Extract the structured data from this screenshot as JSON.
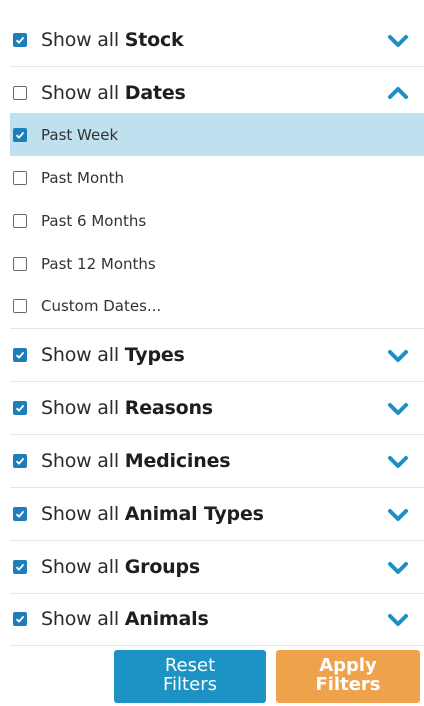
{
  "sections": {
    "stock": {
      "prefix": "Show all",
      "name": "Stock",
      "checked": true,
      "expanded": false
    },
    "dates": {
      "prefix": "Show all",
      "name": "Dates",
      "checked": false,
      "expanded": true
    },
    "types": {
      "prefix": "Show all",
      "name": "Types",
      "checked": true,
      "expanded": false
    },
    "reasons": {
      "prefix": "Show all",
      "name": "Reasons",
      "checked": true,
      "expanded": false
    },
    "medicines": {
      "prefix": "Show all",
      "name": "Medicines",
      "checked": true,
      "expanded": false
    },
    "animal_types": {
      "prefix": "Show all",
      "name": "Animal Types",
      "checked": true,
      "expanded": false
    },
    "groups": {
      "prefix": "Show all",
      "name": "Groups",
      "checked": true,
      "expanded": false
    },
    "animals": {
      "prefix": "Show all",
      "name": "Animals",
      "checked": true,
      "expanded": false
    }
  },
  "date_options": [
    {
      "label": "Past Week",
      "checked": true,
      "selected": true
    },
    {
      "label": "Past Month",
      "checked": false,
      "selected": false
    },
    {
      "label": "Past 6 Months",
      "checked": false,
      "selected": false
    },
    {
      "label": "Past 12 Months",
      "checked": false,
      "selected": false
    },
    {
      "label": "Custom Dates...",
      "checked": false,
      "selected": false
    }
  ],
  "buttons": {
    "reset": {
      "line1": "Reset",
      "line2": "Filters"
    },
    "apply": {
      "line1": "Apply",
      "line2": "Filters"
    }
  },
  "colors": {
    "accent": "#1c7fb9",
    "chevron": "#1c8fc4",
    "selected_row": "#bfe1ef",
    "reset_button": "#1c93c4",
    "apply_button": "#eea24b"
  },
  "icons": {
    "expand": "chevron-down-icon",
    "collapse": "chevron-up-icon",
    "checked": "checkbox-checked-icon",
    "unchecked": "checkbox-unchecked-icon"
  }
}
